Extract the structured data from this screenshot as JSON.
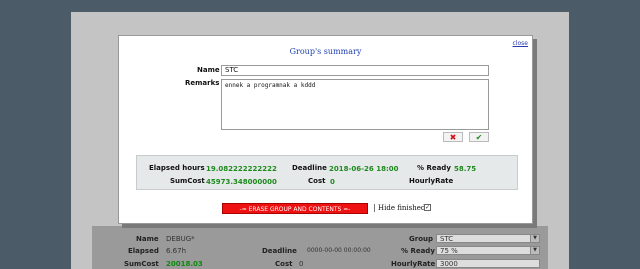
{
  "background": {
    "name_label": "Name",
    "name_value": "DEBUG*",
    "elapsed_label": "Elapsed",
    "elapsed_value": "6.67h",
    "deadline_label": "Deadline",
    "deadline_value": "0000-00-00 00:00:00",
    "sumcost_label": "SumCost",
    "sumcost_value": "20018.03",
    "cost_label": "Cost",
    "cost_value": "0",
    "group_label": "Group",
    "group_value": "STC",
    "ready_label": "% Ready",
    "ready_value": "75 %",
    "hourlyrate_label": "HourlyRate",
    "hourlyrate_value": "3000"
  },
  "modal": {
    "close_label": "close",
    "title": "Group's summary",
    "name_label": "Name",
    "name_value": "STC",
    "remarks_label": "Remarks",
    "remarks_value": "ennek a programnak a kddd",
    "cancel_icon": "x-icon",
    "confirm_icon": "check-icon",
    "stats": {
      "elapsed_label": "Elapsed hours",
      "elapsed_value": "19.082222222222",
      "deadline_label": "Deadline",
      "deadline_value": "2018-06-26 18:00",
      "ready_label": "% Ready",
      "ready_value": "58.75",
      "sumcost_label": "SumCost",
      "sumcost_value": "45973.348000000",
      "cost_label": "Cost",
      "cost_value": "0",
      "hourlyrate_label": "HourlyRate",
      "hourlyrate_value": ""
    },
    "erase_label": "-= ERASE GROUP AND CONTENTS =-",
    "separator": "|",
    "hide_finished_label": "Hide finished",
    "hide_finished_checked": "✓"
  },
  "colors": {
    "page_bg": "#4b5c68",
    "accent_title": "#1d3fb0",
    "value_green": "#1d8a1d",
    "erase_red": "#ee1111"
  }
}
